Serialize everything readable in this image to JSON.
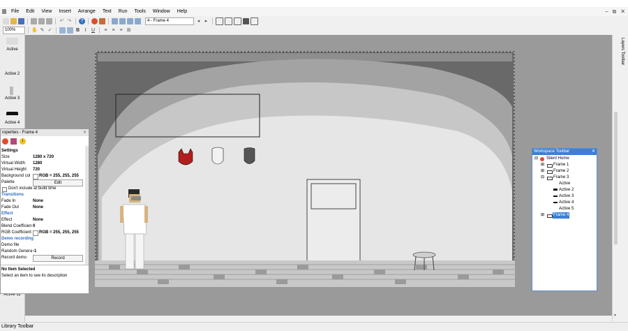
{
  "menubar": {
    "items": [
      "File",
      "Edit",
      "View",
      "Insert",
      "Arrange",
      "Text",
      "Run",
      "Tools",
      "Window",
      "Help"
    ]
  },
  "toolbar": {
    "frame_select": "4 - Frame 4",
    "zoom": "100%"
  },
  "left_strip": {
    "labels": [
      "Active",
      "Active 2",
      "Active 3",
      "Active 4",
      "Active 11"
    ]
  },
  "properties": {
    "title": "roperties - Frame 4",
    "settings_header": "Settings",
    "rows": [
      {
        "k": "Size",
        "v": "1280 x 720"
      },
      {
        "k": "Virtual Width",
        "v": "1280"
      },
      {
        "k": "Virtual Height",
        "v": "720"
      },
      {
        "k": "Background col",
        "v": "RGB = 255, 255, 255"
      },
      {
        "k": "Palette",
        "v": "Edit"
      }
    ],
    "dont_include": "Don't include at build time",
    "transitions_header": "Transitions",
    "fade_in_k": "Fade In",
    "fade_in_v": "None",
    "fade_out_k": "Fade Out",
    "fade_out_v": "None",
    "effect_header": "Effect",
    "effect_k": "Effect",
    "effect_v": "None",
    "blend_k": "Blend Coefficien",
    "blend_v": "0",
    "rgbcoef_k": "RGB Coefficient",
    "rgbcoef_v": "RGB = 255, 255, 255",
    "demo_header": "Demo recording",
    "demo_file_k": "Demo file",
    "random_k": "Random Genera",
    "random_v": "-1",
    "record_k": "Record demo",
    "record_btn": "Record",
    "no_item": "No Item Selected",
    "no_item_desc": "Select an item to see its description"
  },
  "workspace": {
    "title": "Workspace Toolbar",
    "root": "Silent Home",
    "frames": [
      "Frame 1",
      "Frame 2",
      "Frame 3",
      "Frame 4"
    ],
    "frame3_children": [
      "Active",
      "Active 2",
      "Active 3",
      "Active 4",
      "Active 5"
    ]
  },
  "right_strip": {
    "label": "Layers Toolbar"
  },
  "status": {
    "text": "Library Toolbar"
  },
  "colors": {
    "accent": "#3c7fd4",
    "workspace_bg": "#9a9a9a",
    "section": "#2f6fbf"
  }
}
